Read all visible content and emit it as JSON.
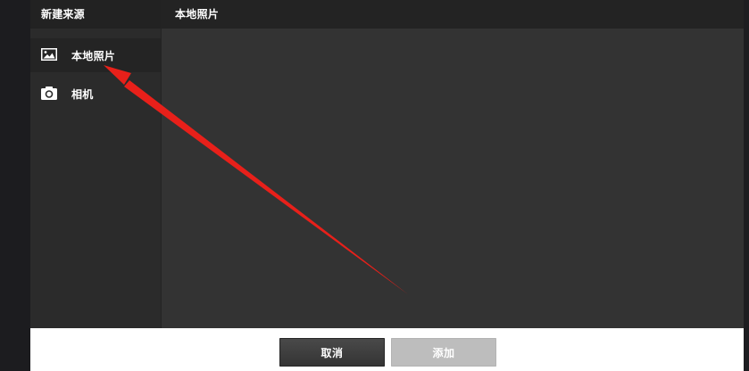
{
  "sidebar": {
    "title": "新建来源",
    "items": [
      {
        "label": "本地照片",
        "icon": "image-icon",
        "active": true
      },
      {
        "label": "相机",
        "icon": "camera-icon",
        "active": false
      }
    ]
  },
  "main": {
    "title": "本地照片"
  },
  "footer": {
    "cancel_label": "取消",
    "add_label": "添加"
  },
  "colors": {
    "dialog_bg": "#2f2f2f",
    "sidebar_bg": "#2b2b2b",
    "header_bg": "#222222",
    "footer_bg": "#ffffff",
    "cancel_btn": "#3f3f3f",
    "add_btn_disabled": "#bdbdbd",
    "annotation_arrow": "#e8201a"
  }
}
